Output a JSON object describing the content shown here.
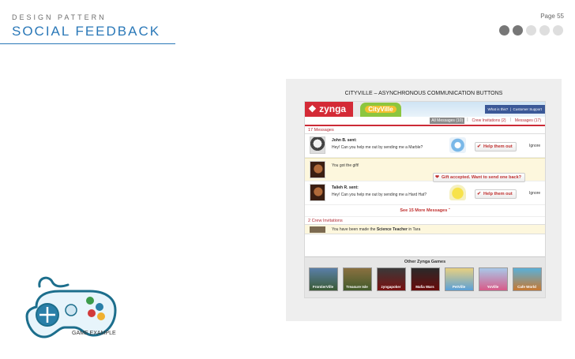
{
  "header": {
    "kicker": "DESIGN PATTERN",
    "title": "SOCIAL FEEDBACK",
    "page": "Page 55",
    "pager": {
      "total": 5,
      "active": 2
    }
  },
  "colors": {
    "accent": "#2a78b8",
    "brand_red": "#d42a36"
  },
  "panel": {
    "caption": "CITYVILLE – ASYNCHRONOUS COMMUNICATION BUTTONS",
    "game": {
      "logo": "zynga",
      "banner": "CityVille",
      "links": [
        "What is this?",
        "Customer Support"
      ],
      "tabs": [
        {
          "label": "All Messages (10)",
          "active": true
        },
        {
          "label": "Crew Invitations (2)",
          "active": false
        },
        {
          "label": "Messages (17)",
          "active": false
        }
      ],
      "messages_header": "17 Messages",
      "messages": [
        {
          "sender": "John B. sent:",
          "text": "Hey! Can you help me out by sending me a Marble?",
          "button": "Help them out",
          "ignore": "Ignore"
        },
        {
          "text": "You got the gift!",
          "button": "Gift accepted. Want to send one back?"
        },
        {
          "sender": "Talieh R. sent:",
          "text": "Hey! Can you help me out by sending me a Hard Hat?",
          "button": "Help them out",
          "ignore": "Ignore"
        }
      ],
      "see_more": "See 15 More Messages",
      "crew_header": "2 Crew Invitations",
      "crew_text_prefix": "You have been made the",
      "crew_role": "Science Teacher",
      "crew_text_suffix": "in Tara",
      "other_games_title": "Other Zynga Games",
      "other_games": [
        "FrontierVille",
        "Treasure Isle",
        "zyngapoker",
        "Mafia Wars",
        "PetVille",
        "YoVille",
        "Cafe World"
      ]
    }
  },
  "game_example_caption": "GAME EXAMPLE",
  "icons": [
    "check-icon",
    "heart-icon",
    "gamepad-icon"
  ]
}
